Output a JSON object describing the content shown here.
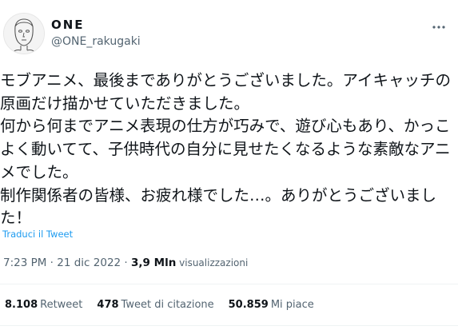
{
  "author": {
    "display_name": "ONE",
    "handle": "@ONE_rakugaki"
  },
  "tweet": {
    "text": "モブアニメ、最後までありがとうございました。アイキャッチの原画だけ描かせていただきました。\n何から何までアニメ表現の仕方が巧みで、遊び心もあり、かっこよく動いてて、子供時代の自分に見せたくなるような素敵なアニメでした。\n制作関係者の皆様、お疲れ様でした…。ありがとうございました！",
    "translate_label": "Traduci il Tweet"
  },
  "meta": {
    "timestamp": "7:23 PM · 21 dic 2022 · ",
    "views_count": "3,9 Mln",
    "views_label": " visualizzazioni"
  },
  "stats": {
    "retweets_count": "8.108",
    "retweets_label": "Retweet",
    "quotes_count": "478",
    "quotes_label": "Tweet di citazione",
    "likes_count": "50.859",
    "likes_label": "Mi piace"
  },
  "icons": {
    "avatar": "avatar-sketch-face",
    "more": "more-options-icon"
  },
  "colors": {
    "link": "#1d9bf0",
    "secondary_text": "#536471",
    "primary_text": "#0f1419"
  }
}
